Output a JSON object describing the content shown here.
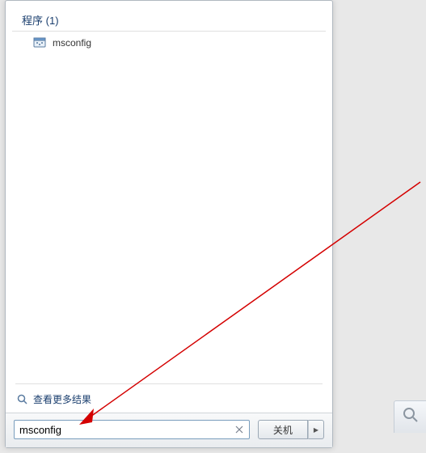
{
  "category": {
    "label": "程序",
    "count": "(1)"
  },
  "results": [
    {
      "label": "msconfig"
    }
  ],
  "more_results_label": "查看更多结果",
  "search": {
    "value": "msconfig",
    "placeholder": ""
  },
  "shutdown": {
    "label": "关机"
  }
}
